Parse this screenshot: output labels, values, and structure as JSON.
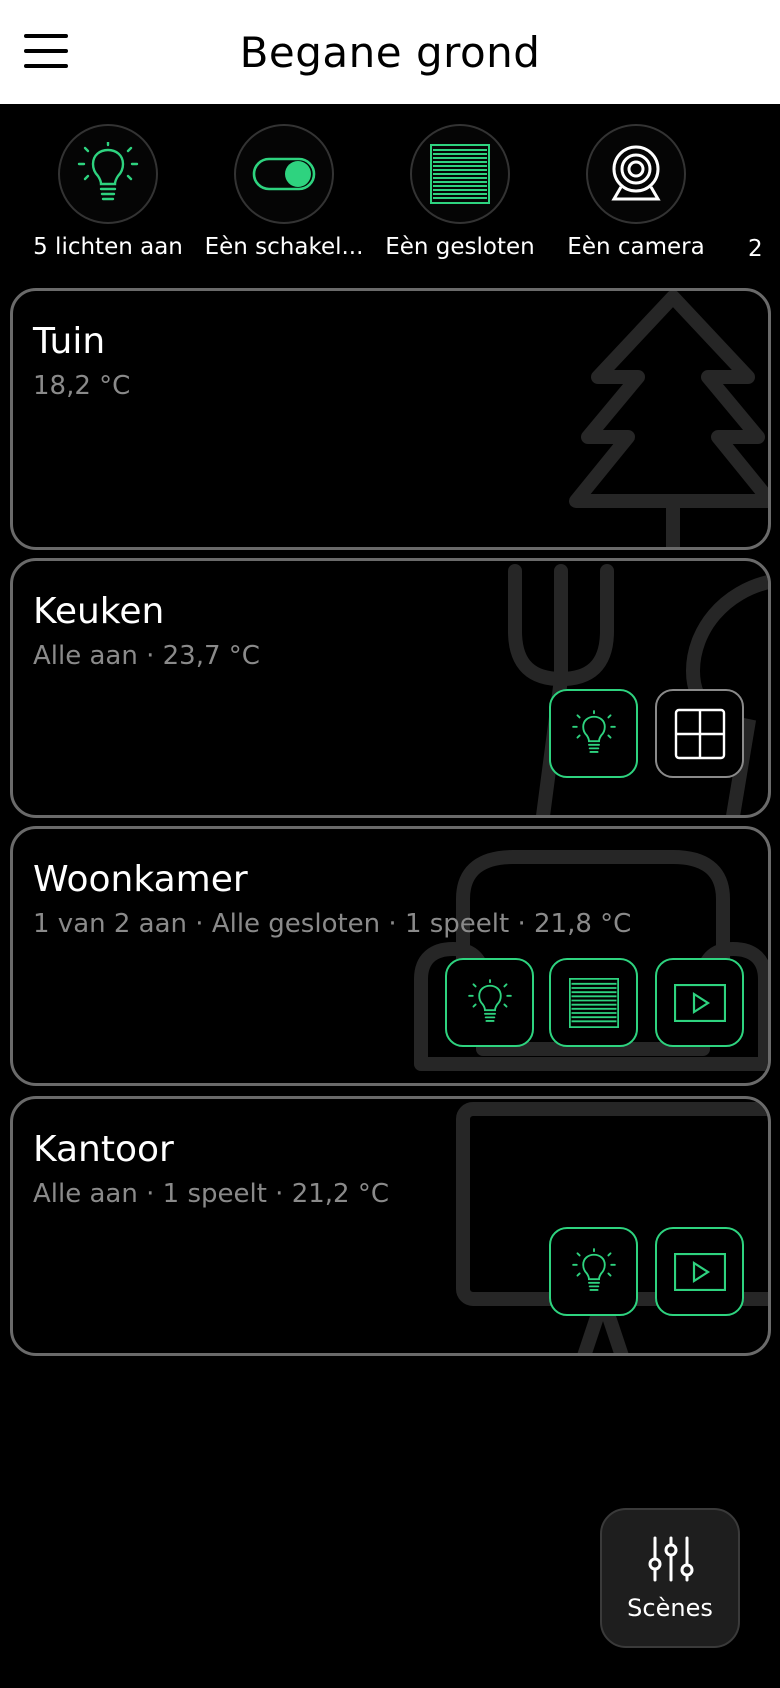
{
  "header": {
    "title": "Begane grond"
  },
  "quick_actions": [
    {
      "label": "5 lichten aan",
      "icon": "bulb-icon"
    },
    {
      "label": "Eèn schakel...",
      "icon": "toggle-icon"
    },
    {
      "label": "Eèn gesloten",
      "icon": "shutter-icon"
    },
    {
      "label": "Eèn camera",
      "icon": "camera-icon"
    },
    {
      "label": "2"
    }
  ],
  "areas": [
    {
      "name": "Tuin",
      "status": "18,2 °C"
    },
    {
      "name": "Keuken",
      "status": "Alle aan · 23,7 °C"
    },
    {
      "name": "Woonkamer",
      "status": "1 van 2 aan · Alle gesloten · 1 speelt · 21,8 °C"
    },
    {
      "name": "Kantoor",
      "status": "Alle aan · 1 speelt · 21,2 °C"
    }
  ],
  "fab": {
    "label": "Scènes"
  },
  "colors": {
    "accent": "#2ed37f",
    "card_border": "#6a6a6a",
    "muted_text": "#8a8a8a"
  }
}
